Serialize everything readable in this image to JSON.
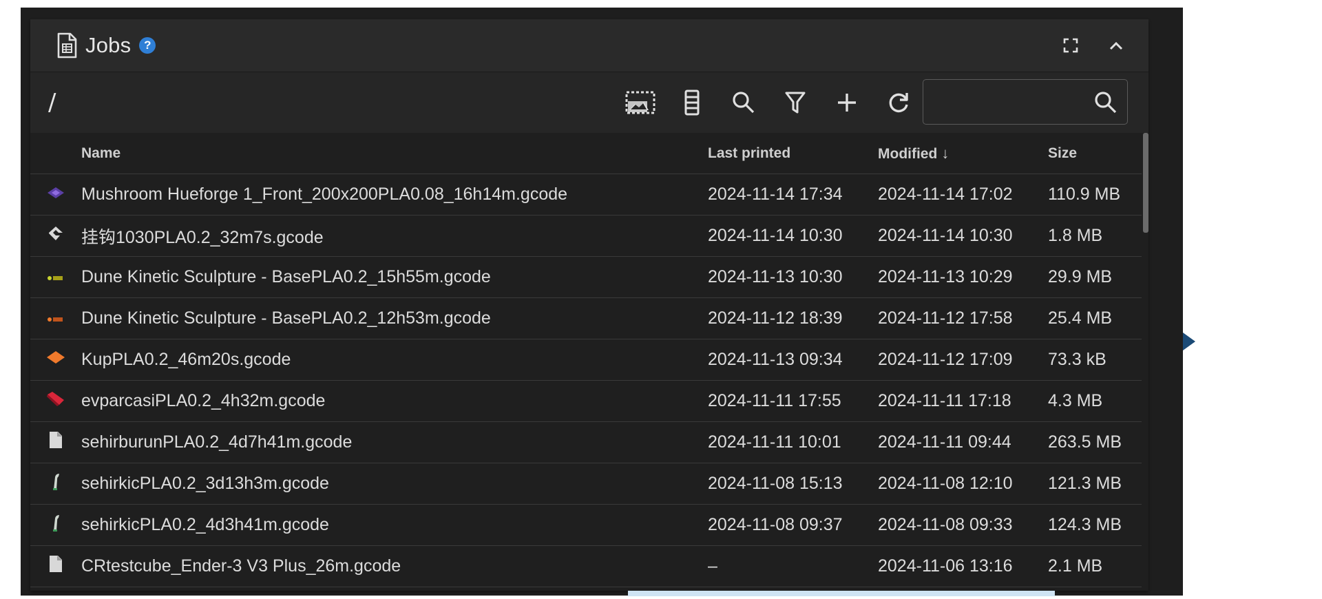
{
  "header": {
    "title": "Jobs",
    "help_badge": "?"
  },
  "toolbar": {
    "path": "/",
    "search": {
      "value": "",
      "placeholder": ""
    }
  },
  "table": {
    "columns": {
      "name": "Name",
      "last_printed": "Last printed",
      "modified": "Modified",
      "size": "Size",
      "sort_indicator": "↓"
    },
    "rows": [
      {
        "icon": "mushroom-thumb-icon",
        "name": "Mushroom Hueforge 1_Front_200x200PLA0.08_16h14m.gcode",
        "last_printed": "2024-11-14 17:34",
        "modified": "2024-11-14 17:02",
        "size": "110.9 MB"
      },
      {
        "icon": "hook-thumb-icon",
        "name": "挂钩1030PLA0.2_32m7s.gcode",
        "last_printed": "2024-11-14 10:30",
        "modified": "2024-11-14 10:30",
        "size": "1.8 MB"
      },
      {
        "icon": "sculpture-yellow-thumb-icon",
        "name": "Dune Kinetic Sculpture - BasePLA0.2_15h55m.gcode",
        "last_printed": "2024-11-13 10:30",
        "modified": "2024-11-13 10:29",
        "size": "29.9 MB"
      },
      {
        "icon": "sculpture-orange-thumb-icon",
        "name": "Dune Kinetic Sculpture - BasePLA0.2_12h53m.gcode",
        "last_printed": "2024-11-12 18:39",
        "modified": "2024-11-12 17:58",
        "size": "25.4 MB"
      },
      {
        "icon": "diamond-thumb-icon",
        "name": "KupPLA0.2_46m20s.gcode",
        "last_printed": "2024-11-13 09:34",
        "modified": "2024-11-12 17:09",
        "size": "73.3 kB"
      },
      {
        "icon": "red-part-thumb-icon",
        "name": "evparcasiPLA0.2_4h32m.gcode",
        "last_printed": "2024-11-11 17:55",
        "modified": "2024-11-11 17:18",
        "size": "4.3 MB"
      },
      {
        "icon": "file-icon",
        "name": "sehirburunPLA0.2_4d7h41m.gcode",
        "last_printed": "2024-11-11 10:01",
        "modified": "2024-11-11 09:44",
        "size": "263.5 MB"
      },
      {
        "icon": "green-part-thumb-icon",
        "name": "sehirkicPLA0.2_3d13h3m.gcode",
        "last_printed": "2024-11-08 15:13",
        "modified": "2024-11-08 12:10",
        "size": "121.3 MB"
      },
      {
        "icon": "green-part-thumb-icon",
        "name": "sehirkicPLA0.2_4d3h41m.gcode",
        "last_printed": "2024-11-08 09:37",
        "modified": "2024-11-08 09:33",
        "size": "124.3 MB"
      },
      {
        "icon": "file-icon",
        "name": "CRtestcube_Ender-3 V3 Plus_26m.gcode",
        "last_printed": "–",
        "modified": "2024-11-06 13:16",
        "size": "2.1 MB"
      }
    ]
  },
  "colors": {
    "background": "#1e1e1e",
    "card": "#282828",
    "help_badge": "#2f7fd6",
    "mushroom_thumb": "#5b3fa6",
    "orange_thumb": "#f07a2c",
    "red_thumb": "#d9263a"
  }
}
